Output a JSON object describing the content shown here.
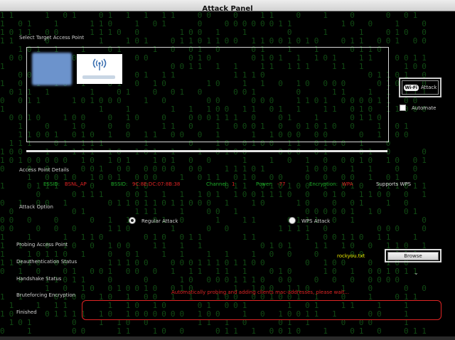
{
  "window": {
    "title": "Attack Panel"
  },
  "labels": {
    "select_target": "Select Target Access Point",
    "ap_details": "Access Point Details",
    "attack_option": "Attack Option",
    "probing": "Probing Access Point",
    "deauth": "Deauthentication Status",
    "handshake": "Handshake Status",
    "bruteforce": "Bruteforcing Encryption",
    "finished": "Finished"
  },
  "attack_button": {
    "badge": "Wi-Fi",
    "label": "Attack"
  },
  "automate": {
    "label": "Automate",
    "checked": false
  },
  "details": {
    "essid_label": "ESSID:",
    "essid_value": "BSNL_AP",
    "bssid_label": "BSSID:",
    "bssid_value": "9C:8E:DC:07:8B:38",
    "channel_label": "Channel:",
    "channel_value": "1",
    "power_label": "Power:",
    "power_value": "-77",
    "encryption_label": "Encryption:",
    "encryption_value": "WPA",
    "wps": "Supports WPS"
  },
  "options": {
    "regular": "Regular Attack",
    "wps": "WPS Attack",
    "selected": "regular"
  },
  "wordlist": {
    "file": "rockyou.txt",
    "browse_label": "Browse"
  },
  "status_message": "Automatically probing and adding clients mac-addresses, please wait...",
  "colors": {
    "accent_green": "#1fae2a",
    "accent_red": "#e02424",
    "wordlist_yellow": "#e8e800"
  }
}
